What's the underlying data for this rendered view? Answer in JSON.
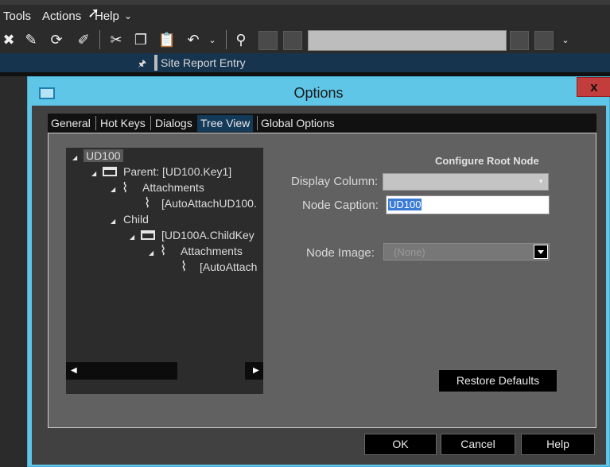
{
  "menu": {
    "tools": "Tools",
    "actions": "Actions",
    "help": "Help",
    "more": "⌄"
  },
  "entry": {
    "pin": "†",
    "title": "Site Report Entry"
  },
  "dialog": {
    "title": "Options",
    "close": "x",
    "tabs": [
      "General",
      "Hot Keys",
      "Dialogs",
      "Tree View",
      "Global Options"
    ],
    "active_tab": "Tree View"
  },
  "tree": {
    "root": "UD100",
    "parent": "Parent: [UD100.Key1]",
    "attachments1": "Attachments",
    "auto1": "[AutoAttachUD100.",
    "child": "Child",
    "childkey": "[UD100A.ChildKey",
    "attachments2": "Attachments",
    "auto2": "[AutoAttach"
  },
  "config": {
    "title": "Configure Root Node",
    "display_column_label": "Display Column:",
    "display_column_value": "",
    "node_caption_label": "Node Caption:",
    "node_caption_value": "UD100",
    "node_image_label": "Node Image:",
    "node_image_value": "(None)"
  },
  "buttons": {
    "restore": "Restore Defaults",
    "ok": "OK",
    "cancel": "Cancel",
    "help": "Help"
  },
  "colors": {
    "dialog_frame": "#5fc6e8",
    "entry_bar": "#17344f",
    "active_tab": "#143a59",
    "close": "#c43d3d"
  }
}
